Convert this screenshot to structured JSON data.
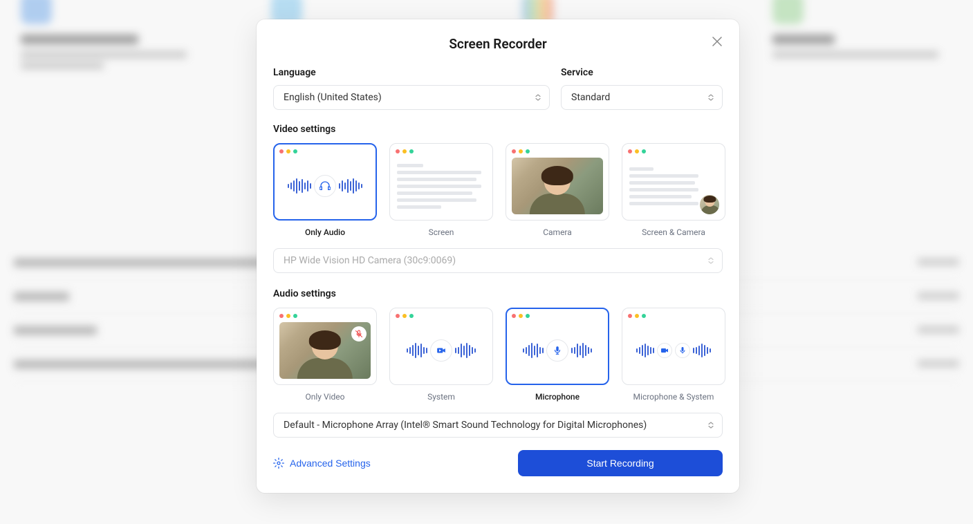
{
  "modal": {
    "title": "Screen Recorder",
    "language_label": "Language",
    "language_value": "English (United States)",
    "service_label": "Service",
    "service_value": "Standard",
    "video_settings_label": "Video settings",
    "video_options": {
      "only_audio": "Only Audio",
      "screen": "Screen",
      "camera": "Camera",
      "screen_camera": "Screen & Camera"
    },
    "camera_device": "HP Wide Vision HD Camera (30c9:0069)",
    "audio_settings_label": "Audio settings",
    "audio_options": {
      "only_video": "Only Video",
      "system": "System",
      "microphone": "Microphone",
      "mic_system": "Microphone & System"
    },
    "mic_device": "Default - Microphone Array (Intel® Smart Sound Technology for Digital Microphones)",
    "advanced_settings": "Advanced Settings",
    "start_button": "Start Recording"
  }
}
